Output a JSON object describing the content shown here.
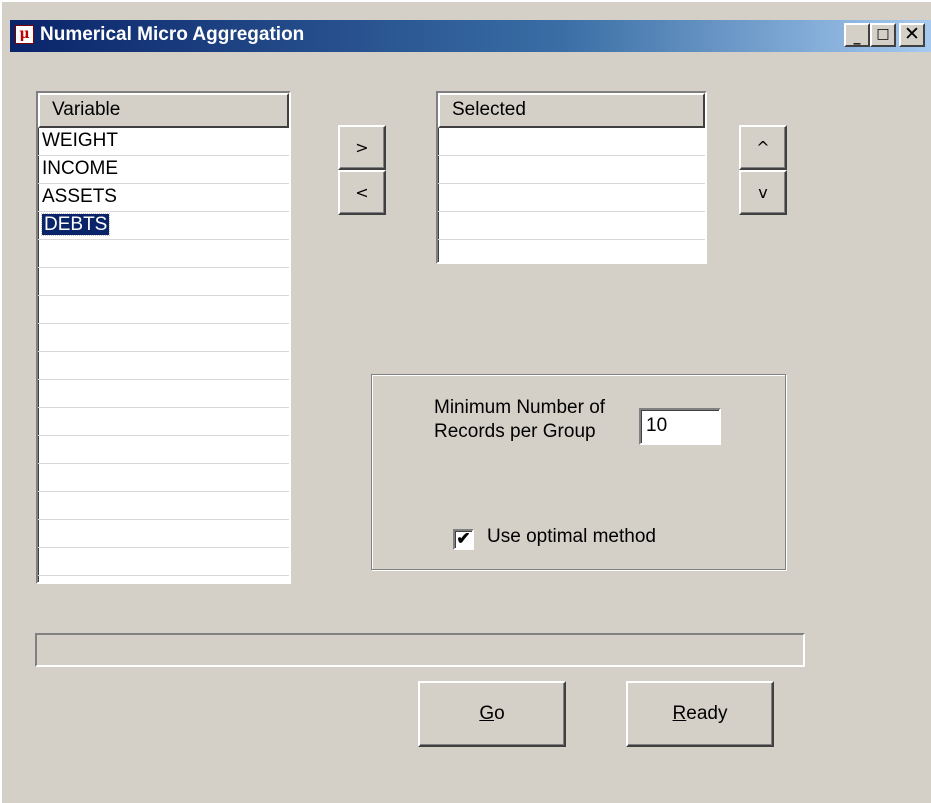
{
  "window": {
    "title": "Numerical Micro Aggregation",
    "icon": "app-icon",
    "icon_glyph": "μ",
    "controls": {
      "minimize": "_",
      "maximize": "□",
      "close": "✕"
    }
  },
  "variables_list": {
    "header": "Variable",
    "items": [
      "WEIGHT",
      "INCOME",
      "ASSETS",
      "DEBTS"
    ],
    "selected_item": "DEBTS"
  },
  "transfer_buttons": {
    "add": ">",
    "remove": "<"
  },
  "selected_list": {
    "header": "Selected",
    "items": []
  },
  "order_buttons": {
    "up": "^",
    "down": "v"
  },
  "parameters": {
    "min_records_label": "Minimum Number of Records per Group",
    "min_records_value": "10",
    "optimal_label": "Use optimal method",
    "optimal_checked": true,
    "check_glyph": "✔"
  },
  "progress": {
    "value": 0
  },
  "actions": {
    "go_mnemonic": "G",
    "go_rest": "o",
    "ready_mnemonic": "R",
    "ready_rest": "eady"
  },
  "colors": {
    "face": "#d4d0c8",
    "selection": "#0a246a",
    "title_gradient_start": "#0a246a",
    "title_gradient_end": "#a6caf0"
  }
}
